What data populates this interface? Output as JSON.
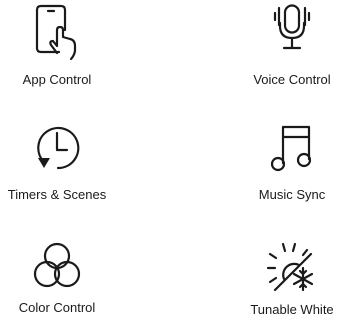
{
  "features": [
    {
      "label": "App Control",
      "icon": "phone-touch-icon"
    },
    {
      "label": "Voice Control",
      "icon": "microphone-icon"
    },
    {
      "label": "Timers & Scenes",
      "icon": "clock-icon"
    },
    {
      "label": "Music Sync",
      "icon": "music-note-icon"
    },
    {
      "label": "Color Control",
      "icon": "color-circles-icon"
    },
    {
      "label": "Tunable White",
      "icon": "sun-snowflake-icon"
    }
  ],
  "colors": {
    "icon": "#1a1a1a",
    "text": "#1a1a1a",
    "background": "#ffffff"
  }
}
